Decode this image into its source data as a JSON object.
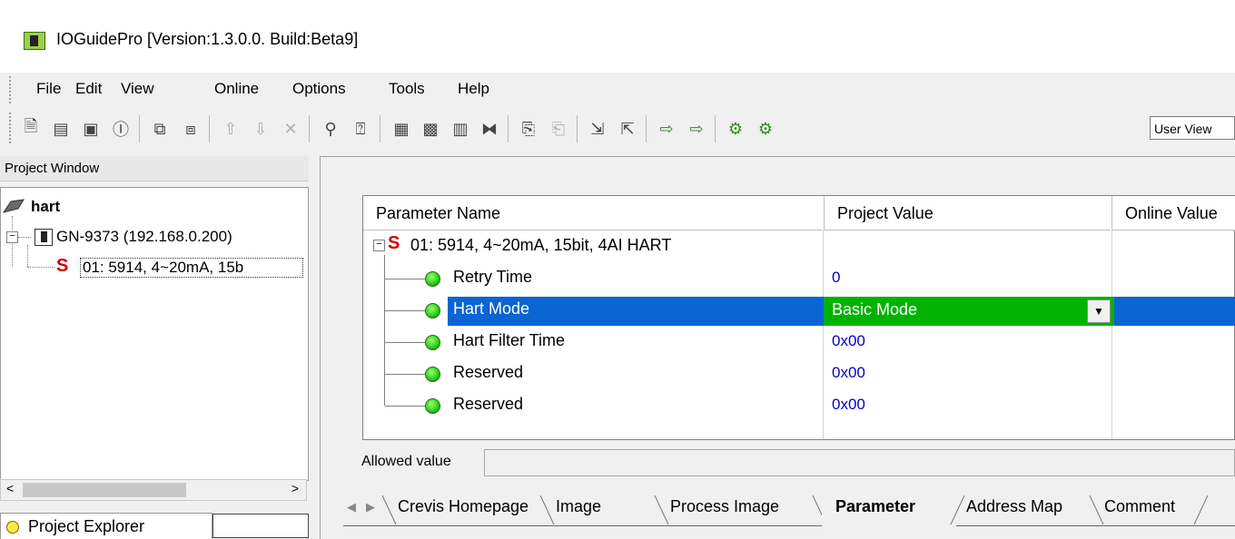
{
  "window": {
    "title": "IOGuidePro  [Version:1.3.0.0. Build:Beta9]"
  },
  "menu": {
    "items": [
      "File",
      "Edit",
      "View",
      "Online",
      "Options",
      "Tools",
      "Help"
    ]
  },
  "toolbar": {
    "view_select": "User View"
  },
  "project": {
    "header": "Project Window",
    "tree": {
      "root": "hart",
      "device": "GN-9373 (192.168.0.200)",
      "module": "01: 5914, 4~20mA, 15b"
    },
    "explorer_tab": "Project Explorer"
  },
  "grid": {
    "columns": [
      "Parameter Name",
      "Project Value",
      "Online Value"
    ],
    "module_row": "01: 5914, 4~20mA, 15bit, 4AI HART",
    "rows": [
      {
        "name": "Retry Time",
        "value": "0"
      },
      {
        "name": "Hart Mode",
        "value": "Basic Mode"
      },
      {
        "name": "Hart Filter Time",
        "value": "0x00"
      },
      {
        "name": "Reserved",
        "value": "0x00"
      },
      {
        "name": "Reserved",
        "value": "0x00"
      }
    ],
    "selected_row_color": "#0a64d2",
    "selected_value_color": "#00b300"
  },
  "allowed": {
    "label": "Allowed value",
    "value": ""
  },
  "tabs": [
    "Crevis Homepage",
    "Image",
    "Process Image",
    "Parameter",
    "Address Map",
    "Comment"
  ],
  "active_tab": "Parameter"
}
